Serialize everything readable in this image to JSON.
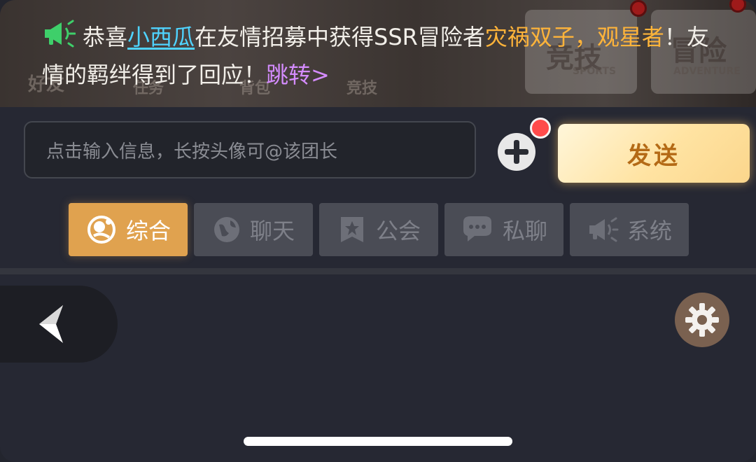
{
  "banner": {
    "background_labels": [
      "好友",
      "任务",
      "背包",
      "竞技",
      "竞技",
      "冒险",
      "SPORTS",
      "ADVENTURE"
    ],
    "prefix": "恭喜",
    "user_name": "小西瓜",
    "middle": "在友情招募中获得SSR冒险者",
    "hero_name": "灾祸双子，观星者",
    "suffix": "！友情的羁绊得到了回应！",
    "jump_link": "跳转>"
  },
  "input": {
    "placeholder": "点击输入信息，长按头像可@该团长"
  },
  "send_button": {
    "label": "发送"
  },
  "tabs": [
    {
      "label": "综合",
      "icon": "chat-bubble-icon",
      "active": true
    },
    {
      "label": "聊天",
      "icon": "globe-icon",
      "active": false
    },
    {
      "label": "公会",
      "icon": "guild-banner-icon",
      "active": false
    },
    {
      "label": "私聊",
      "icon": "private-chat-icon",
      "active": false
    },
    {
      "label": "系统",
      "icon": "megaphone-icon",
      "active": false
    }
  ],
  "colors": {
    "accent": "#e0a24f",
    "user_link": "#4fd3ff",
    "hero_highlight": "#ffb43a",
    "jump_link": "#d58cff",
    "notification_dot": "#ff4b4b"
  },
  "controls": {
    "back_icon": "chevron-left-icon",
    "settings_icon": "gear-icon"
  }
}
